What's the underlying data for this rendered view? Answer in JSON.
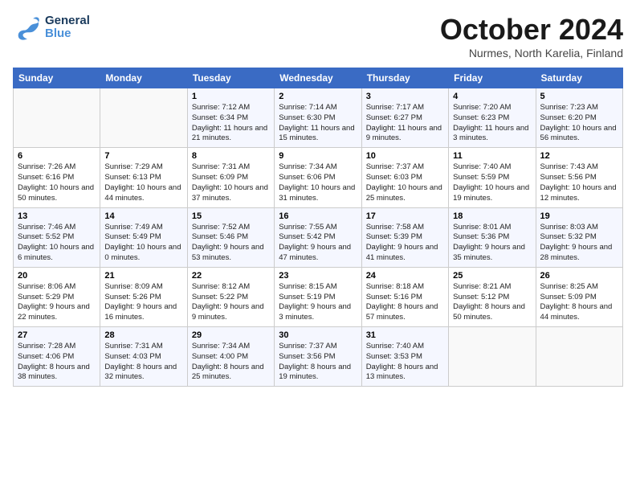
{
  "header": {
    "logo_line1": "General",
    "logo_line2": "Blue",
    "month": "October 2024",
    "location": "Nurmes, North Karelia, Finland"
  },
  "weekdays": [
    "Sunday",
    "Monday",
    "Tuesday",
    "Wednesday",
    "Thursday",
    "Friday",
    "Saturday"
  ],
  "weeks": [
    [
      {
        "day": null,
        "content": ""
      },
      {
        "day": null,
        "content": ""
      },
      {
        "day": "1",
        "content": "Sunrise: 7:12 AM\nSunset: 6:34 PM\nDaylight: 11 hours and 21 minutes."
      },
      {
        "day": "2",
        "content": "Sunrise: 7:14 AM\nSunset: 6:30 PM\nDaylight: 11 hours and 15 minutes."
      },
      {
        "day": "3",
        "content": "Sunrise: 7:17 AM\nSunset: 6:27 PM\nDaylight: 11 hours and 9 minutes."
      },
      {
        "day": "4",
        "content": "Sunrise: 7:20 AM\nSunset: 6:23 PM\nDaylight: 11 hours and 3 minutes."
      },
      {
        "day": "5",
        "content": "Sunrise: 7:23 AM\nSunset: 6:20 PM\nDaylight: 10 hours and 56 minutes."
      }
    ],
    [
      {
        "day": "6",
        "content": "Sunrise: 7:26 AM\nSunset: 6:16 PM\nDaylight: 10 hours and 50 minutes."
      },
      {
        "day": "7",
        "content": "Sunrise: 7:29 AM\nSunset: 6:13 PM\nDaylight: 10 hours and 44 minutes."
      },
      {
        "day": "8",
        "content": "Sunrise: 7:31 AM\nSunset: 6:09 PM\nDaylight: 10 hours and 37 minutes."
      },
      {
        "day": "9",
        "content": "Sunrise: 7:34 AM\nSunset: 6:06 PM\nDaylight: 10 hours and 31 minutes."
      },
      {
        "day": "10",
        "content": "Sunrise: 7:37 AM\nSunset: 6:03 PM\nDaylight: 10 hours and 25 minutes."
      },
      {
        "day": "11",
        "content": "Sunrise: 7:40 AM\nSunset: 5:59 PM\nDaylight: 10 hours and 19 minutes."
      },
      {
        "day": "12",
        "content": "Sunrise: 7:43 AM\nSunset: 5:56 PM\nDaylight: 10 hours and 12 minutes."
      }
    ],
    [
      {
        "day": "13",
        "content": "Sunrise: 7:46 AM\nSunset: 5:52 PM\nDaylight: 10 hours and 6 minutes."
      },
      {
        "day": "14",
        "content": "Sunrise: 7:49 AM\nSunset: 5:49 PM\nDaylight: 10 hours and 0 minutes."
      },
      {
        "day": "15",
        "content": "Sunrise: 7:52 AM\nSunset: 5:46 PM\nDaylight: 9 hours and 53 minutes."
      },
      {
        "day": "16",
        "content": "Sunrise: 7:55 AM\nSunset: 5:42 PM\nDaylight: 9 hours and 47 minutes."
      },
      {
        "day": "17",
        "content": "Sunrise: 7:58 AM\nSunset: 5:39 PM\nDaylight: 9 hours and 41 minutes."
      },
      {
        "day": "18",
        "content": "Sunrise: 8:01 AM\nSunset: 5:36 PM\nDaylight: 9 hours and 35 minutes."
      },
      {
        "day": "19",
        "content": "Sunrise: 8:03 AM\nSunset: 5:32 PM\nDaylight: 9 hours and 28 minutes."
      }
    ],
    [
      {
        "day": "20",
        "content": "Sunrise: 8:06 AM\nSunset: 5:29 PM\nDaylight: 9 hours and 22 minutes."
      },
      {
        "day": "21",
        "content": "Sunrise: 8:09 AM\nSunset: 5:26 PM\nDaylight: 9 hours and 16 minutes."
      },
      {
        "day": "22",
        "content": "Sunrise: 8:12 AM\nSunset: 5:22 PM\nDaylight: 9 hours and 9 minutes."
      },
      {
        "day": "23",
        "content": "Sunrise: 8:15 AM\nSunset: 5:19 PM\nDaylight: 9 hours and 3 minutes."
      },
      {
        "day": "24",
        "content": "Sunrise: 8:18 AM\nSunset: 5:16 PM\nDaylight: 8 hours and 57 minutes."
      },
      {
        "day": "25",
        "content": "Sunrise: 8:21 AM\nSunset: 5:12 PM\nDaylight: 8 hours and 50 minutes."
      },
      {
        "day": "26",
        "content": "Sunrise: 8:25 AM\nSunset: 5:09 PM\nDaylight: 8 hours and 44 minutes."
      }
    ],
    [
      {
        "day": "27",
        "content": "Sunrise: 7:28 AM\nSunset: 4:06 PM\nDaylight: 8 hours and 38 minutes."
      },
      {
        "day": "28",
        "content": "Sunrise: 7:31 AM\nSunset: 4:03 PM\nDaylight: 8 hours and 32 minutes."
      },
      {
        "day": "29",
        "content": "Sunrise: 7:34 AM\nSunset: 4:00 PM\nDaylight: 8 hours and 25 minutes."
      },
      {
        "day": "30",
        "content": "Sunrise: 7:37 AM\nSunset: 3:56 PM\nDaylight: 8 hours and 19 minutes."
      },
      {
        "day": "31",
        "content": "Sunrise: 7:40 AM\nSunset: 3:53 PM\nDaylight: 8 hours and 13 minutes."
      },
      {
        "day": null,
        "content": ""
      },
      {
        "day": null,
        "content": ""
      }
    ]
  ]
}
